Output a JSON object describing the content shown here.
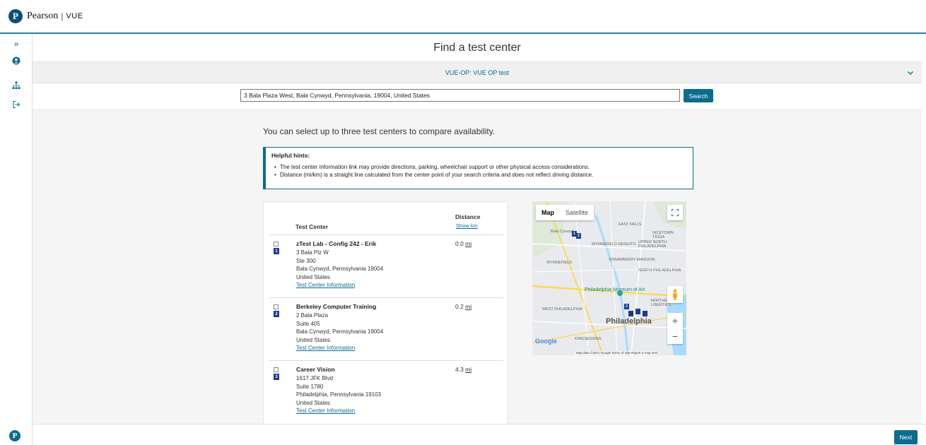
{
  "header": {
    "logo_letter": "P",
    "brand": "Pearson",
    "separator": "|",
    "product": "VUE"
  },
  "sidebar": {
    "items": [
      {
        "icon": "expand-icon",
        "glyph": "»"
      },
      {
        "icon": "user-icon"
      },
      {
        "icon": "sitemap-icon"
      },
      {
        "icon": "sign-out-icon"
      }
    ],
    "bottom_logo": "P"
  },
  "main": {
    "title": "Find a test center",
    "exam": "VUE-OP: VUE OP test",
    "search": {
      "value": "3 Bala Plaza West, Bala Cynwyd, Pennsylvania, 19004, United States",
      "button_label": "Search"
    },
    "intro": "You can select up to three test centers to compare availability.",
    "hints": {
      "title": "Helpful hints:",
      "items": [
        "The test center information link may provide directions, parking, wheelchair support or other physical access considerations.",
        "Distance (mi/km) is a straight line calculated from the center point of your search criteria and does not reflect driving distance."
      ]
    },
    "table": {
      "col_center": "Test Center",
      "col_distance": "Distance",
      "show_km": "Show km",
      "rows": [
        {
          "pin": "1",
          "name": "zTest Lab - Config 242 - Erik",
          "address": [
            "3 Bala Plz W",
            "Ste 300",
            "Bala Cynwyd, Pennsylvania 19004",
            "United States"
          ],
          "info_link": "Test Center Information",
          "distance": "0.0",
          "unit": "mi"
        },
        {
          "pin": "2",
          "name": "Berkeley Computer Training",
          "address": [
            "2 Bala Plaza",
            "Suite 405",
            "Bala Cynwyd, Pennsylvania 19004",
            "United States"
          ],
          "info_link": "Test Center Information",
          "distance": "0.2",
          "unit": "mi"
        },
        {
          "pin": "3",
          "name": "Career Vision",
          "address": [
            "1617 JFK Blvd",
            "Suite 1780",
            "Philadelphia, Pennsylvania 19103",
            "United States"
          ],
          "info_link": "Test Center Information",
          "distance": "4.3",
          "unit": "mi"
        }
      ]
    },
    "map": {
      "tab_map": "Map",
      "tab_satellite": "Satellite",
      "city_label": "Philadelphia",
      "museum_label": "Philadelphia Museum of Art",
      "labels": [
        "Bala Cynwyd",
        "EAST FALLS",
        "NICETOWN TIOGA",
        "UPPER NORTH PHILADELPHIA",
        "WYNNEFIELD HEIGHTS",
        "WYNNEFIELD",
        "STRAWBERRY MANSION",
        "NORTH PHILADELPHIA",
        "WEST PHILADELPHIA",
        "NORTHERN LIBERTIES",
        "KINGSESSING"
      ],
      "google": "Google",
      "footer": "Map data ©2021 Google   Terms of Use   Report a map error",
      "zoom_in": "+",
      "zoom_out": "−"
    },
    "next_label": "Next"
  },
  "colors": {
    "accent": "#0a6c8f",
    "pin": "#1a3d8f"
  }
}
